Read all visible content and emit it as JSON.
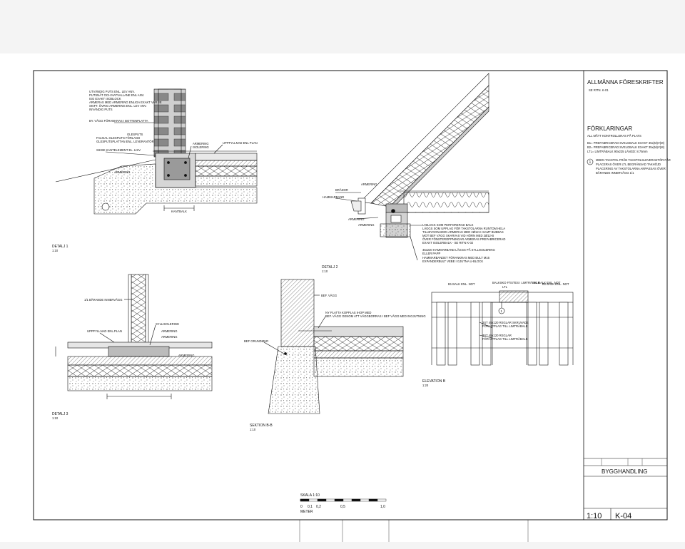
{
  "title_block": {
    "general_title": "ALLMÄNNA FÖRESKRIFTER",
    "general_ref": "SE RITN. K-01",
    "legend_title": "FÖRKLARINGAR",
    "legend_lines": [
      "ALL MÅTT KONTROLLERAS PÅ PLATS",
      "B1= PREFABRICERAD SVELGBALK EXAKT 35x(M)V(M)",
      "B2= PREFABRICERAD SVELGBALK EXAKT 35x(M)V(M)",
      "LTL= LIMTRÄBALK 90x225 LÄNGD: 8.75mm"
    ],
    "note_number": "1",
    "note_lines": [
      "MEEN TAKSTOL FRÅN TAKSTOLSLEVERANTÖR FÅR",
      "PLACERAS ÖVER LTL BEGRÄNSAD TAKHÖJD",
      "PLACERING AV TAKSTOLARNA ANPASSAS ÖVER",
      "BÄRANDE INNERVÄGG 1/1"
    ],
    "revision_cell": "BYGGHANDLING",
    "scale": "1:10",
    "drawing_number": "K-04"
  },
  "scale_bar": {
    "label": "SKALA 1:10",
    "ticks": [
      "0",
      "0,1",
      "0,2",
      "0,5",
      "1,0"
    ],
    "unit": "METER"
  },
  "details": [
    {
      "title": "DETALJ 1",
      "scale": "1:10"
    },
    {
      "title": "DETALJ 2",
      "scale": "1:10"
    },
    {
      "title": "DETALJ 3",
      "scale": "1:10"
    },
    {
      "title": "SEKTION B-B",
      "scale": "1:10"
    },
    {
      "title": "ELEVATION B",
      "scale": "1:20"
    }
  ],
  "detail1_notes": [
    "UTVÄNDIG PUTS ENL. LEV ANV.",
    "PUTSNÄT OCH NATVALLANE ENL ANV.",
    "ISO EXAKT ISOBLOCK",
    "ARMERAS MED ARMERING ENLIGA EXAKT VAR 3E",
    "SKIFT. ÖVRIG ARMERING ENL. LEV ANV.",
    "INVÄNDIG PUTS"
  ],
  "detail1_labels": [
    "BY. VÄGG FÖRANKRAS I BOTTENPLATTA",
    "GLESPUTS",
    "FALKIAL GLESPUTS FÖRLAGD",
    "GLESPUTSPLATTAN ENL. LEVERANTÖR",
    "SIKSE KANTELEMENT EL. LIKV",
    "UPPFYLLNAD ENL PLAN",
    "ARMERING",
    "ISOLERING",
    "ARMERING",
    "KANTBALK"
  ],
  "detail2_labels": [
    "U-BLOCK SOM PERFORERAD BALK",
    "LÄGGS SOM UPPLAG FÖR TAKSTOLARNA RUNTOM HELA",
    "TILLBYGGNADEN ARMERAS MED 2Ø12-K SAMT BUBBAS",
    "MOT BEF VÄGG SKARVAS VID HÖRN MED 2Ø12-B",
    "ÖVER FÖNSTEROPPNINGAR ARMERAS PREFABRICERAD",
    "EXAKT ISOLERBALK - SE RITN K-02",
    "45x220 HAMMARBAND LÄGGS PÅ SYLLISOLERING",
    "ELLER PAPP",
    "HAMMARBANDET FÖRANKRAS MED BULT M16",
    "EXPANDERBULT VEBE I GJUTNA U-BLOCK",
    "HAMMARBAND",
    "BRÄDOR",
    "ARMERING",
    "ARMERING",
    "ARMERING"
  ],
  "detail3_labels": [
    "1/1 BÄRANDE INNERVÄGG",
    "UPPFYLLNAD ENL.PLAN",
    "SYLLISOLERING",
    "ARMERING",
    "ARMERING",
    "ARMERING"
  ],
  "section_labels": [
    "BEF. VÄGG",
    "NY PLATTA KOPPLAS IHOP MED",
    "BEF. VÄGG GENOM ATT VÄGGBORRAS I BEF VÄGG MED INGJUTNING",
    "BEF GRUNDMUR"
  ],
  "elevation_labels": [
    "B1 BALK ENL. NOT",
    "BALKSKO FÄSTES I LIMTRÄBALK",
    "LTL",
    "B1 BALK ENL. NOT",
    "B1 BALK ENL. NOT",
    "2ST 45x120 REGLAR SKRUVADE",
    "FÖR UPPLAG TILL LIMTRÄBALK",
    "3ST 45x120 REGLAR",
    "FÖR UPPLAG TILL LIMTRÄBALK",
    "1"
  ],
  "colors": {
    "ink": "#111111",
    "hatch": "#333333",
    "paper": "#ffffff"
  }
}
